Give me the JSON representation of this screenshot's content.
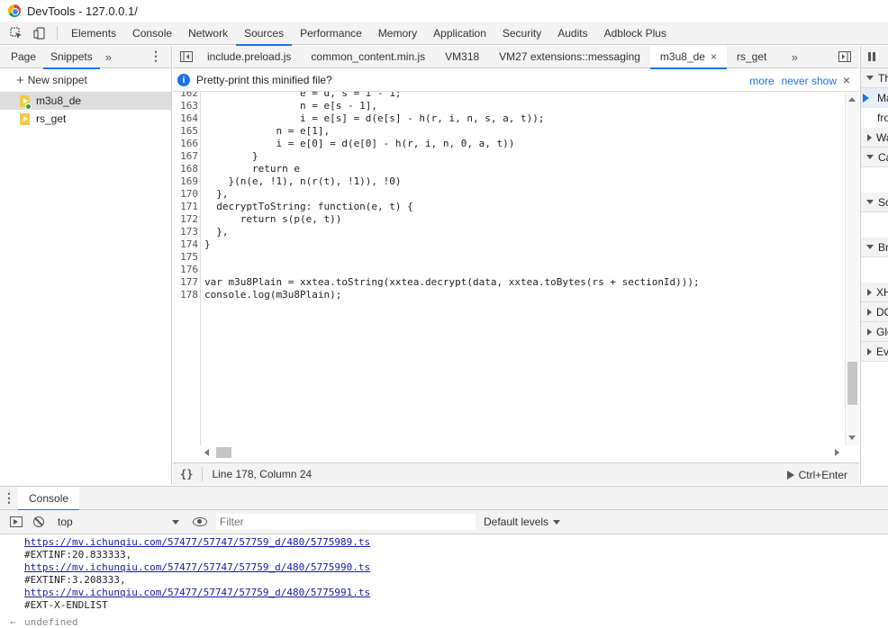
{
  "window": {
    "title": "DevTools - 127.0.0.1/"
  },
  "main_tabs": [
    "Elements",
    "Console",
    "Network",
    "Sources",
    "Performance",
    "Memory",
    "Application",
    "Security",
    "Audits",
    "Adblock Plus"
  ],
  "main_tab_active": "Sources",
  "navigator": {
    "tabs": [
      "Page",
      "Snippets"
    ],
    "more": "»",
    "new_snippet_label": "New snippet",
    "snippets": [
      {
        "name": "m3u8_de",
        "selected": true
      },
      {
        "name": "rs_get",
        "selected": false
      }
    ]
  },
  "editor_tabs": [
    {
      "label": "include.preload.js",
      "active": false
    },
    {
      "label": "common_content.min.js",
      "active": false
    },
    {
      "label": "VM318",
      "active": false
    },
    {
      "label": "VM27 extensions::messaging",
      "active": false
    },
    {
      "label": "m3u8_de",
      "active": true,
      "close": "×"
    },
    {
      "label": "rs_get",
      "active": false
    }
  ],
  "editor_more": "»",
  "infobar": {
    "message": "Pretty-print this minified file?",
    "more": "more",
    "never_show": "never show",
    "close": "×"
  },
  "code_lines": [
    {
      "n": "162",
      "text": "                e = d, s = i - 1;"
    },
    {
      "n": "163",
      "text": "                n = e[s - 1],"
    },
    {
      "n": "164",
      "text": "                i = e[s] = d(e[s] - h(r, i, n, s, a, t));"
    },
    {
      "n": "165",
      "text": "            n = e[1],"
    },
    {
      "n": "166",
      "text": "            i = e[0] = d(e[0] - h(r, i, n, 0, a, t))"
    },
    {
      "n": "167",
      "text": "        }"
    },
    {
      "n": "168",
      "text": "        return e"
    },
    {
      "n": "169",
      "text": "    }(n(e, !1), n(r(t), !1)), !0)"
    },
    {
      "n": "170",
      "text": "  },"
    },
    {
      "n": "171",
      "text": "  decryptToString: function(e, t) {"
    },
    {
      "n": "172",
      "text": "      return s(p(e, t))"
    },
    {
      "n": "173",
      "text": "  },"
    },
    {
      "n": "174",
      "text": "}"
    },
    {
      "n": "175",
      "text": ""
    },
    {
      "n": "176",
      "text": ""
    },
    {
      "n": "177",
      "text": "var m3u8Plain = xxtea.toString(xxtea.decrypt(data, xxtea.toBytes(rs + sectionId)));"
    },
    {
      "n": "178",
      "text": "console.log(m3u8Plain);"
    }
  ],
  "statusbar": {
    "format_icon": "{}",
    "position": "Line 178, Column 24",
    "run": "Ctrl+Enter"
  },
  "debugger_panes": [
    {
      "label": "Threads",
      "expanded": true
    },
    {
      "label": "Main",
      "body": true,
      "current": true
    },
    {
      "label": "from",
      "body": true
    },
    {
      "label": "Watch",
      "expanded": false
    },
    {
      "label": "Call Stack",
      "expanded": true
    },
    {
      "label": "Scope",
      "expanded": true
    },
    {
      "label": "Breakpoints",
      "expanded": true
    },
    {
      "label": "XHR/fetch Breakpoints",
      "expanded": false
    },
    {
      "label": "DOM Breakpoints",
      "expanded": false
    },
    {
      "label": "Global Listeners",
      "expanded": false
    },
    {
      "label": "Event Listener Breakpoints",
      "expanded": false
    }
  ],
  "console": {
    "drawer_tab": "Console",
    "context": "top",
    "filter_placeholder": "Filter",
    "levels": "Default levels",
    "lines": [
      {
        "text": "https://mv.ichunqiu.com/57477/57747/57759_d/480/5775989.ts",
        "link": true
      },
      {
        "text": "#EXTINF:20.833333,",
        "link": false
      },
      {
        "text": "https://mv.ichunqiu.com/57477/57747/57759_d/480/5775990.ts",
        "link": true
      },
      {
        "text": "#EXTINF:3.208333,",
        "link": false
      },
      {
        "text": "https://mv.ichunqiu.com/57477/57747/57759_d/480/5775991.ts",
        "link": true
      },
      {
        "text": "#EXT-X-ENDLIST",
        "link": false
      }
    ],
    "result_arrow": "←",
    "result": "undefined"
  }
}
